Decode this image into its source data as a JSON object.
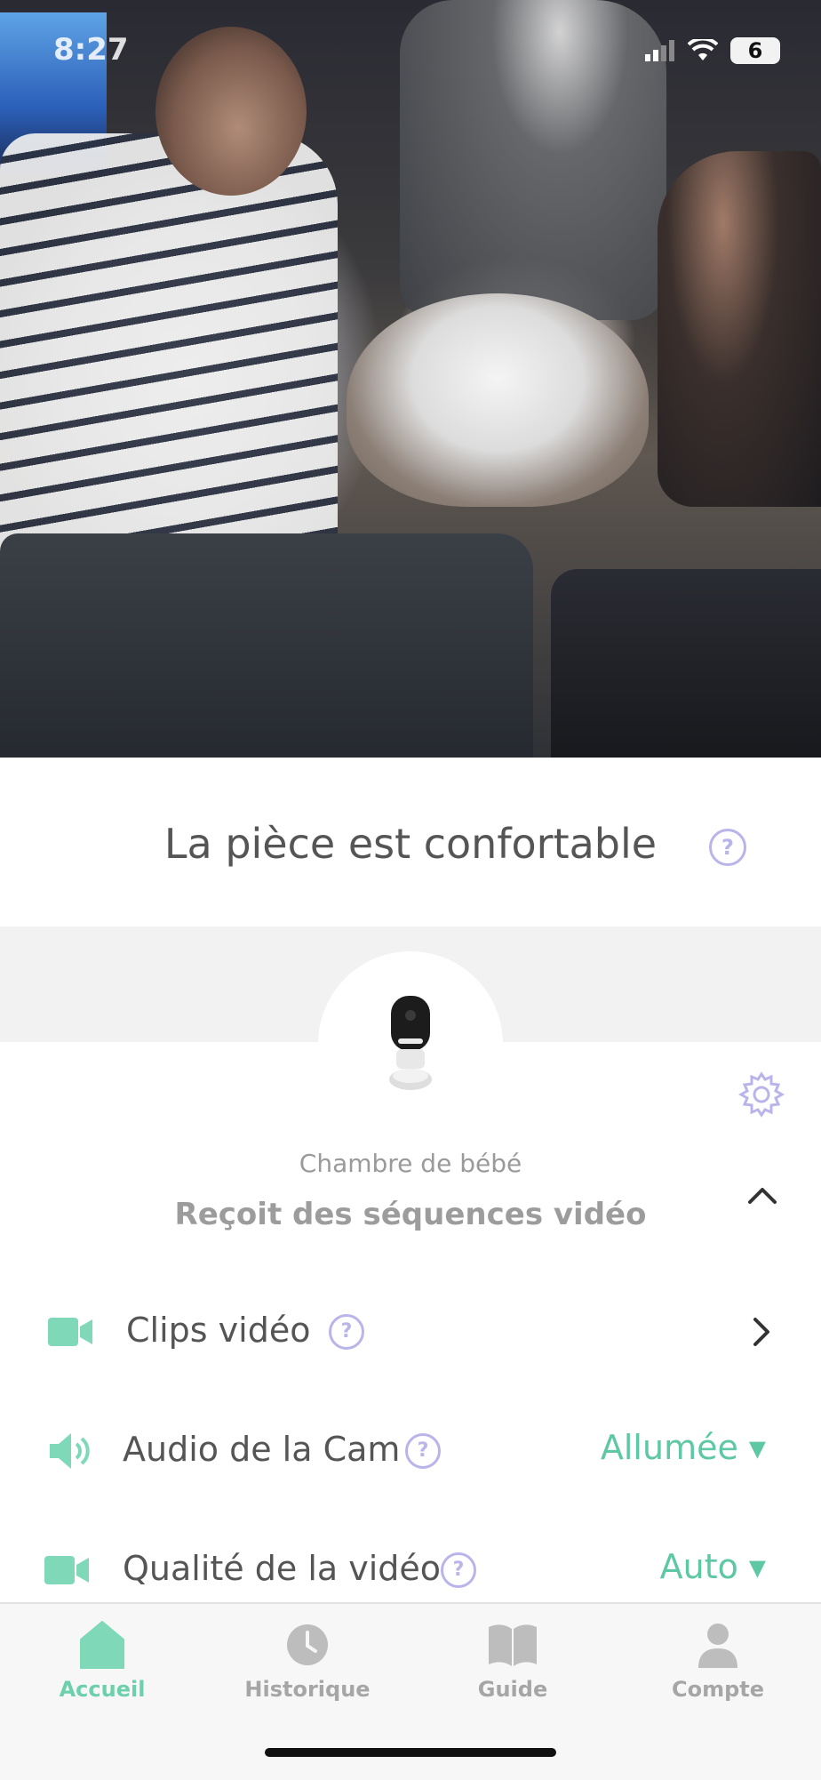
{
  "status_bar": {
    "time": "8:27",
    "battery": "6"
  },
  "room_comfort": {
    "text": "La pièce est confortable",
    "help": "?"
  },
  "camera": {
    "room_name": "Chambre de bébé",
    "status": "Reçoit des séquences vidéo",
    "icon": "camera-device-icon"
  },
  "settings_rows": [
    {
      "label": "Clips vidéo",
      "help": "?",
      "icon": "video-camera-icon",
      "action": "chevron-right-icon"
    },
    {
      "label": "Audio de la Cam",
      "help": "?",
      "icon": "speaker-icon",
      "value": "Allumée ▾"
    },
    {
      "label": "Qualité de la vidéo",
      "help": "?",
      "icon": "video-camera-icon",
      "value": "Auto ▾"
    }
  ],
  "tabs": [
    {
      "label": "Accueil",
      "icon": "home-icon",
      "active": true
    },
    {
      "label": "Historique",
      "icon": "clock-icon",
      "active": false
    },
    {
      "label": "Guide",
      "icon": "book-icon",
      "active": false
    },
    {
      "label": "Compte",
      "icon": "person-icon",
      "active": false
    }
  ],
  "colors": {
    "accent": "#5ec7a4",
    "help": "#b9b5ea",
    "text": "#555555"
  }
}
